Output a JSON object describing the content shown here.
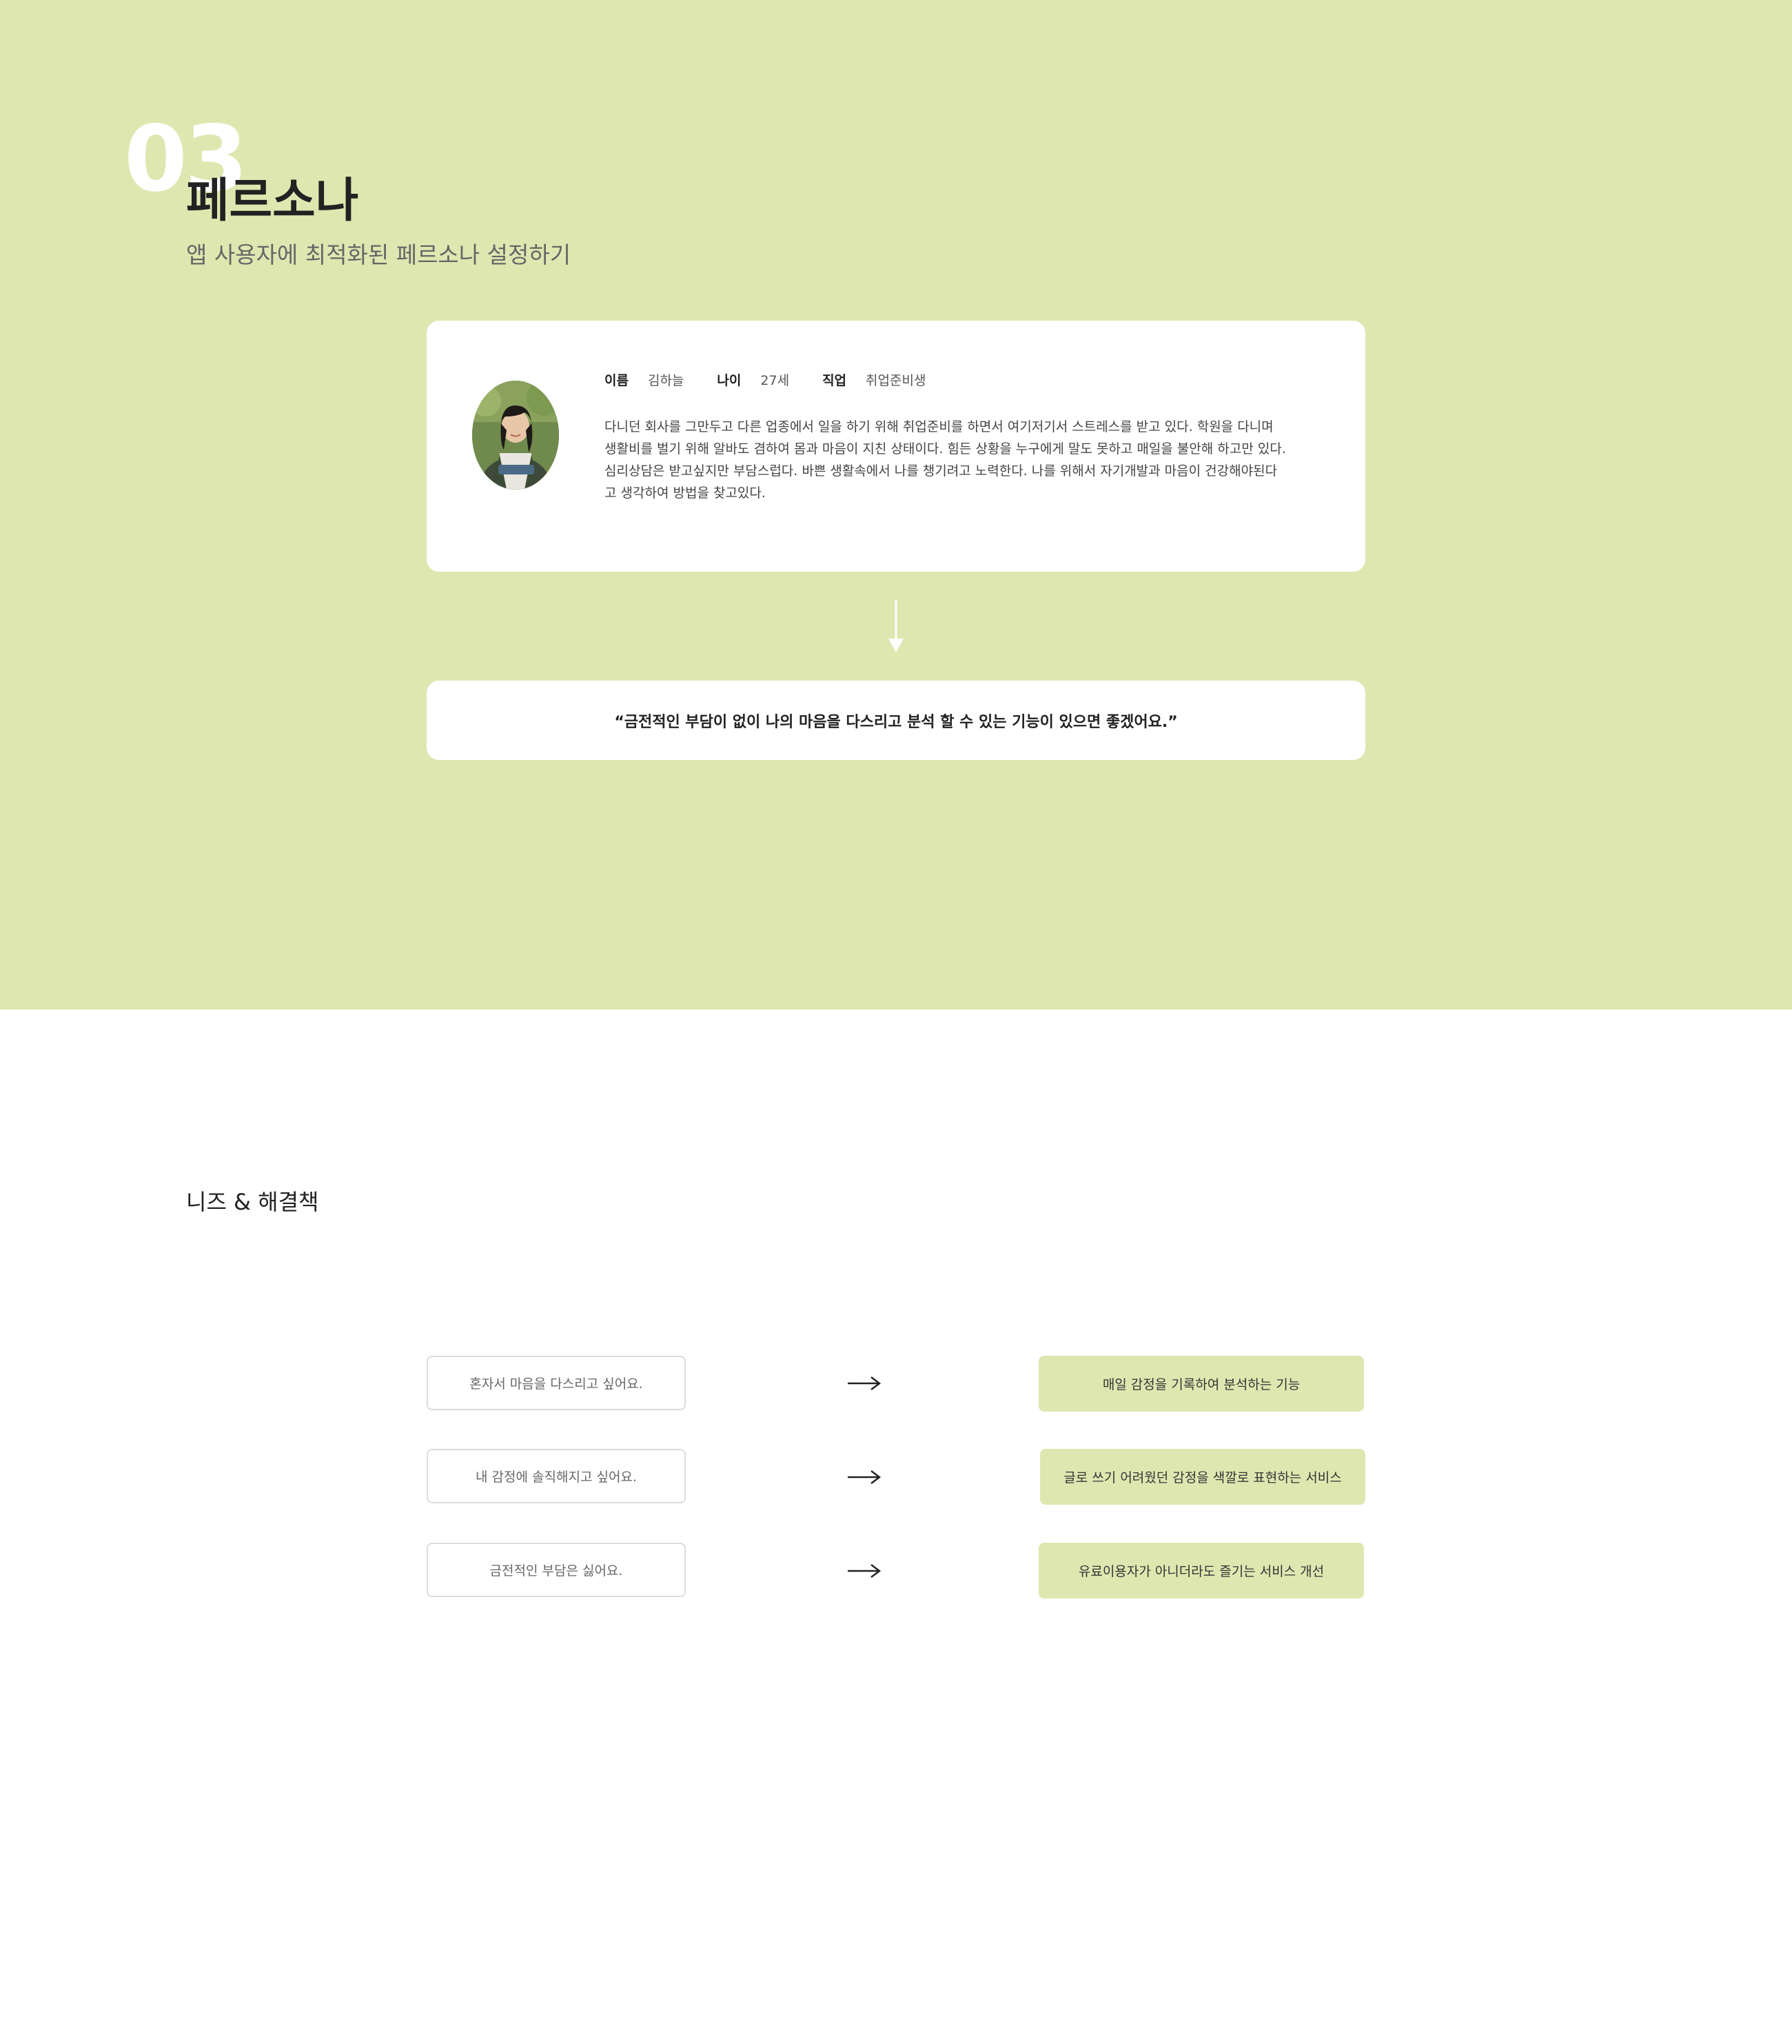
{
  "persona_section": {
    "number": "03",
    "title": "페르소나",
    "subtitle": "앱 사용자에 최적화된 페르소나 설정하기",
    "persona": {
      "name_label": "이름",
      "name": "김하늘",
      "age_label": "나이",
      "age": "27세",
      "job_label": "직업",
      "job": "취업준비생",
      "description_lines": [
        "다니던 회사를 그만두고 다른 업종에서 일을 하기 위해 취업준비를 하면서 여기저기서 스트레스를 받고 있다. 학원을 다니며",
        "생활비를 벌기 위해 알바도 겸하여 몸과 마음이 지친 상태이다. 힘든 상황을 누구에게 말도 못하고 매일을 불안해 하고만 있다.",
        "심리상담은 받고싶지만 부담스럽다. 바쁜 생활속에서 나를 챙기려고 노력한다. 나를 위해서 자기개발과 마음이 건강해야된다",
        "고 생각하여 방법을 찾고있다."
      ]
    },
    "quote": "“금전적인 부담이 없이 나의 마음을 다스리고 분석 할 수 있는 기능이 있으면 좋겠어요.”"
  },
  "needs_section": {
    "heading": "니즈 & 해결책",
    "rows": [
      {
        "need": "혼자서 마음을 다스리고 싶어요.",
        "solution": "매일 감정을 기록하여 분석하는 기능"
      },
      {
        "need": "내 감정에 솔직해지고 싶어요.",
        "solution": "글로 쓰기 어려웠던 감정을 색깔로 표현하는 서비스"
      },
      {
        "need": "금전적인 부담은 싫어요.",
        "solution": "유료이용자가 아니더라도 즐기는 서비스 개선"
      }
    ]
  },
  "colors": {
    "accent_green": "#dfe7b1",
    "section_number": "#ffffff",
    "text_dark": "#222222"
  },
  "icons": {
    "down_arrow": "arrow-down-icon",
    "row_arrow": "arrow-right-icon",
    "avatar": "persona-photo"
  }
}
